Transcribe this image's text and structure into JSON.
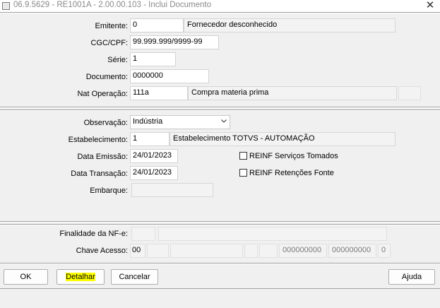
{
  "window": {
    "title": "06.9.5629 - RE1001A - 2.00.00.103 - Inclui Documento",
    "close_glyph": "✕"
  },
  "header_section": {
    "emitente": {
      "label": "Emitente:",
      "value": "0",
      "description": "Fornecedor desconhecido"
    },
    "cgc_cpf": {
      "label": "CGC/CPF:",
      "value": "99.999.999/9999-99"
    },
    "serie": {
      "label": "Série:",
      "value": "1"
    },
    "documento": {
      "label": "Documento:",
      "value": "0000000"
    },
    "nat_operacao": {
      "label": "Nat Operação:",
      "value": "111a",
      "description": "Compra materia prima",
      "extra": ""
    }
  },
  "details_section": {
    "observacao": {
      "label": "Observação:",
      "value": "Indústria"
    },
    "estabelecimento": {
      "label": "Estabelecimento:",
      "value": "1",
      "description": "Estabelecimento TOTVS - AUTOMAÇÃO"
    },
    "data_emissao": {
      "label": "Data Emissão:",
      "value": "24/01/2023"
    },
    "data_transacao": {
      "label": "Data Transação:",
      "value": "24/01/2023"
    },
    "embarque": {
      "label": "Embarque:",
      "value": ""
    },
    "reinf_servicos": {
      "label": "REINF Serviços Tomados",
      "checked": false
    },
    "reinf_retencoes": {
      "label": "REINF Retenções Fonte",
      "checked": false
    }
  },
  "nfe_section": {
    "finalidade": {
      "label": "Finalidade da NF-e:",
      "code": "",
      "description": ""
    },
    "chave_acesso": {
      "label": "Chave Acesso:",
      "parts": [
        "00",
        "",
        "",
        "",
        "",
        "000000000",
        "000000000",
        "0"
      ]
    }
  },
  "buttons": {
    "ok": "OK",
    "detalhar": "Detalhar",
    "cancelar": "Cancelar",
    "ajuda": "Ajuda"
  }
}
